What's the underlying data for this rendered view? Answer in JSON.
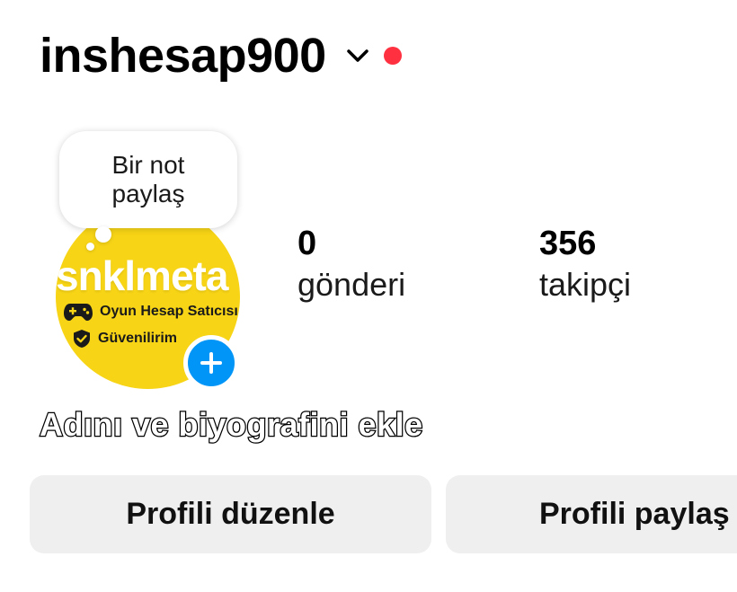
{
  "header": {
    "username": "inshesap900",
    "chevron_icon": "chevron-down-icon",
    "notification_color": "#ff3040"
  },
  "note": {
    "text": "Bir not paylaş"
  },
  "avatar": {
    "brand": "snklmeta",
    "line1": "Oyun Hesap Satıcısı",
    "line2": "Güvenilirim",
    "background": "#f7d416",
    "add_icon": "plus-icon",
    "add_color": "#0095f6"
  },
  "stats": {
    "posts": {
      "value": "0",
      "label": "gönderi"
    },
    "followers": {
      "value": "356",
      "label": "takipçi"
    }
  },
  "bio_cta": "Adını ve biyografini ekle",
  "buttons": {
    "edit_profile": "Profili düzenle",
    "share_profile": "Profili paylaş"
  }
}
